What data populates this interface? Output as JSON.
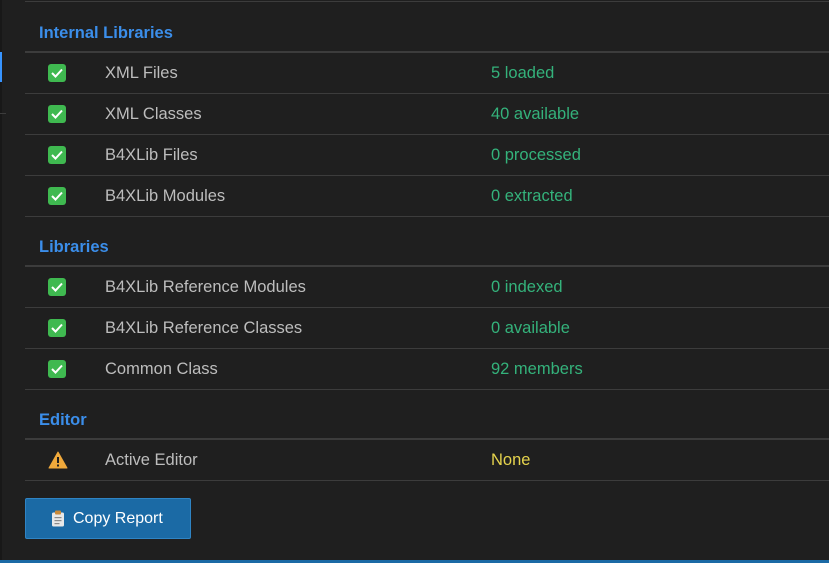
{
  "sections": [
    {
      "title": "Internal Libraries",
      "rows": [
        {
          "status": "ok",
          "label": "XML Files",
          "value": "5 loaded"
        },
        {
          "status": "ok",
          "label": "XML Classes",
          "value": "40 available"
        },
        {
          "status": "ok",
          "label": "B4XLib Files",
          "value": "0 processed"
        },
        {
          "status": "ok",
          "label": "B4XLib Modules",
          "value": "0 extracted"
        }
      ]
    },
    {
      "title": "Libraries",
      "rows": [
        {
          "status": "ok",
          "label": "B4XLib Reference Modules",
          "value": "0 indexed"
        },
        {
          "status": "ok",
          "label": "B4XLib Reference Classes",
          "value": "0 available"
        },
        {
          "status": "ok",
          "label": "Common Class",
          "value": "92 members"
        }
      ]
    },
    {
      "title": "Editor",
      "rows": [
        {
          "status": "warn",
          "label": "Active Editor",
          "value": "None"
        }
      ]
    }
  ],
  "copy_button": {
    "label": "Copy Report",
    "icon": "clipboard-icon"
  },
  "colors": {
    "background": "#1f1f1f",
    "section_title": "#3b8eea",
    "ok_value": "#34b27b",
    "warn_value": "#e5d34d",
    "check_bg": "#3fb950",
    "button_bg": "#1b6aa5"
  },
  "icons": {
    "ok": "check-icon",
    "warn": "warning-icon"
  }
}
